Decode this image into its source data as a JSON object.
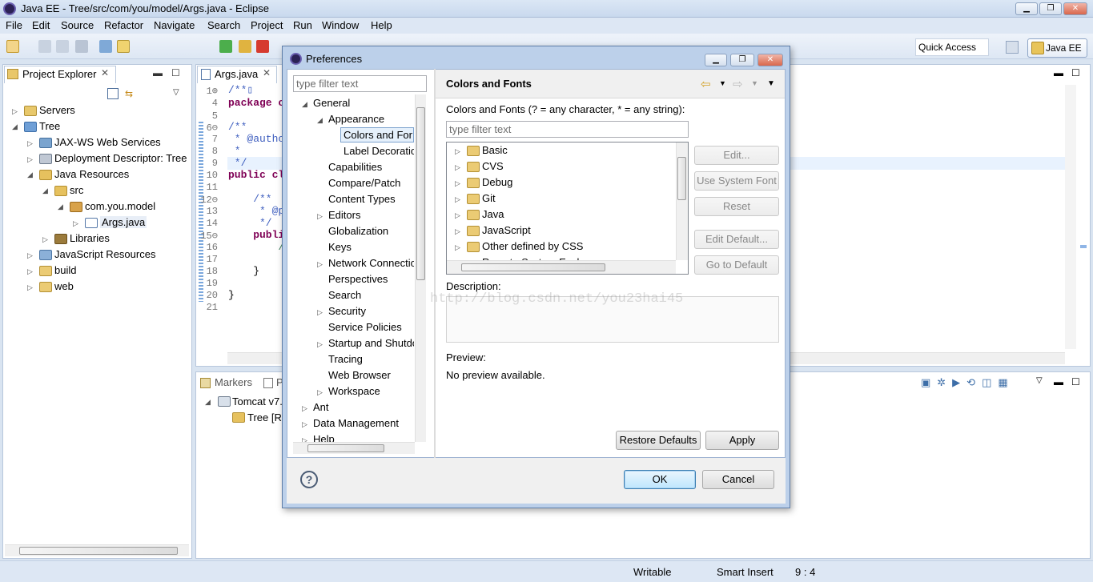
{
  "window": {
    "title": "Java EE - Tree/src/com/you/model/Args.java - Eclipse",
    "minimize": "▁",
    "restore": "❐",
    "close": "✕"
  },
  "menu": [
    "File",
    "Edit",
    "Source",
    "Refactor",
    "Navigate",
    "Search",
    "Project",
    "Run",
    "Window",
    "Help"
  ],
  "toolbar": {
    "quick_access": "Quick Access",
    "perspective": "Java EE"
  },
  "project_explorer": {
    "tab": "Project Explorer",
    "items": [
      {
        "label": "Servers",
        "icon": "servers-icon"
      },
      {
        "label": "Tree",
        "icon": "project-icon"
      },
      {
        "label": "JAX-WS Web Services",
        "icon": "webservices-icon"
      },
      {
        "label": "Deployment Descriptor: Tree",
        "icon": "descriptor-icon"
      },
      {
        "label": "Java Resources",
        "icon": "java-resources-icon"
      },
      {
        "label": "src",
        "icon": "package-folder-icon"
      },
      {
        "label": "com.you.model",
        "icon": "package-icon"
      },
      {
        "label": "Args.java",
        "icon": "java-file-icon"
      },
      {
        "label": "Libraries",
        "icon": "libraries-icon"
      },
      {
        "label": "JavaScript Resources",
        "icon": "js-resources-icon"
      },
      {
        "label": "build",
        "icon": "folder-icon"
      },
      {
        "label": "web",
        "icon": "folder-icon"
      }
    ]
  },
  "editor": {
    "tab": "Args.java",
    "line_numbers": [
      "1⊕",
      "4",
      "5",
      "6⊖",
      "7",
      "8",
      "9",
      "10",
      "11",
      "12⊖",
      "13",
      "14",
      "15⊖",
      "16",
      "17",
      "18",
      "19",
      "20",
      "21"
    ],
    "lines": [
      "/**▯",
      "package co",
      "",
      "/**",
      " * @author",
      " *",
      " */",
      "public cla",
      "",
      "    /**",
      "     * @pa",
      "     */",
      "    publi",
      "        //",
      "",
      "    }",
      "",
      "}",
      ""
    ]
  },
  "bottom_panel": {
    "tabs": [
      "Markers",
      "P"
    ],
    "rows": [
      "Tomcat v7.",
      "Tree  [R"
    ]
  },
  "dialog": {
    "title": "Preferences",
    "filter_placeholder": "type filter text",
    "tree": [
      {
        "label": "General",
        "level": 0,
        "expanded": true
      },
      {
        "label": "Appearance",
        "level": 1,
        "expanded": true
      },
      {
        "label": "Colors and Fonts",
        "level": 2,
        "selected": true
      },
      {
        "label": "Label Decorations",
        "level": 2
      },
      {
        "label": "Capabilities",
        "level": 1
      },
      {
        "label": "Compare/Patch",
        "level": 1
      },
      {
        "label": "Content Types",
        "level": 1
      },
      {
        "label": "Editors",
        "level": 1,
        "collapsed": true
      },
      {
        "label": "Globalization",
        "level": 1
      },
      {
        "label": "Keys",
        "level": 1
      },
      {
        "label": "Network Connections",
        "level": 1,
        "collapsed": true
      },
      {
        "label": "Perspectives",
        "level": 1
      },
      {
        "label": "Search",
        "level": 1
      },
      {
        "label": "Security",
        "level": 1,
        "collapsed": true
      },
      {
        "label": "Service Policies",
        "level": 1
      },
      {
        "label": "Startup and Shutdown",
        "level": 1,
        "collapsed": true
      },
      {
        "label": "Tracing",
        "level": 1
      },
      {
        "label": "Web Browser",
        "level": 1
      },
      {
        "label": "Workspace",
        "level": 1,
        "collapsed": true
      },
      {
        "label": "Ant",
        "level": 0,
        "collapsed": true
      },
      {
        "label": "Data Management",
        "level": 0,
        "collapsed": true
      },
      {
        "label": "Help",
        "level": 0,
        "collapsed": true
      }
    ],
    "page_title": "Colors and Fonts",
    "page_desc": "Colors and Fonts (? = any character, * = any string):",
    "page_filter_placeholder": "type filter text",
    "categories": [
      "Basic",
      "CVS",
      "Debug",
      "Git",
      "Java",
      "JavaScript",
      "Other defined by CSS",
      "Remote System Explorer"
    ],
    "side_buttons": [
      "Edit...",
      "Use System Font",
      "Reset",
      "Edit Default...",
      "Go to Default"
    ],
    "description_label": "Description:",
    "watermark": "http://blog.csdn.net/you23hai45",
    "preview_label": "Preview:",
    "preview_text": "No preview available.",
    "restore_defaults": "Restore Defaults",
    "apply": "Apply",
    "ok": "OK",
    "cancel": "Cancel",
    "help_icon": "?"
  },
  "status": {
    "writable": "Writable",
    "insert_mode": "Smart Insert",
    "position": "9 : 4"
  }
}
